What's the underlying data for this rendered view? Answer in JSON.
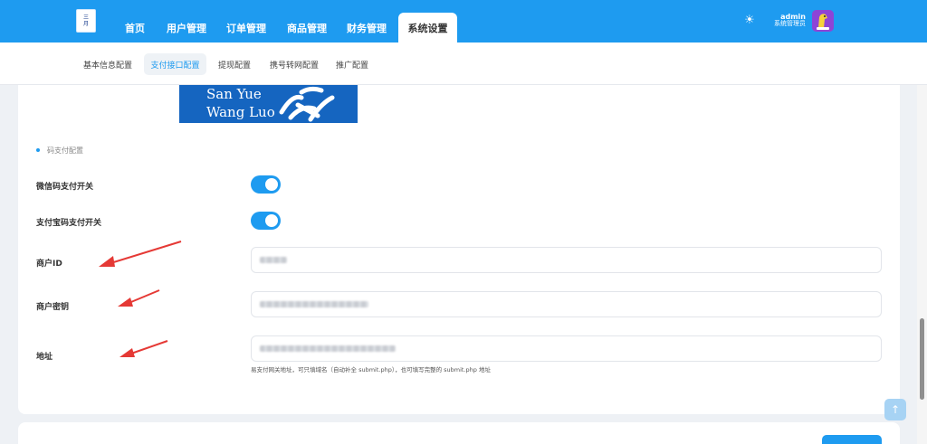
{
  "logo": {
    "chars": [
      "三",
      "月",
      "网",
      "络"
    ]
  },
  "nav": {
    "items": [
      {
        "label": "首页",
        "active": false
      },
      {
        "label": "用户管理",
        "active": false
      },
      {
        "label": "订单管理",
        "active": false
      },
      {
        "label": "商品管理",
        "active": false
      },
      {
        "label": "财务管理",
        "active": false
      },
      {
        "label": "系统设置",
        "active": true
      }
    ]
  },
  "header": {
    "theme_icon": "sun-icon",
    "user_name": "admin",
    "user_role": "系统管理员"
  },
  "subnav": {
    "items": [
      {
        "label": "基本信息配置",
        "active": false
      },
      {
        "label": "支付接口配置",
        "active": true
      },
      {
        "label": "提现配置",
        "active": false
      },
      {
        "label": "携号转网配置",
        "active": false
      },
      {
        "label": "推广配置",
        "active": false
      }
    ]
  },
  "banner": {
    "line1": "San Yue",
    "line2": "Wang Luo"
  },
  "section": {
    "title": "码支付配置"
  },
  "form": {
    "wechat_switch": {
      "label": "微信码支付开关",
      "on": true
    },
    "alipay_switch": {
      "label": "支付宝码支付开关",
      "on": true
    },
    "merchant_id": {
      "label": "商户ID"
    },
    "merchant_key": {
      "label": "商户密钥"
    },
    "address": {
      "label": "地址",
      "help": "易支付网关地址，可只填域名（自动补全 submit.php），也可填写完整的 submit.php 地址"
    }
  },
  "colors": {
    "primary": "#1e9bf0",
    "arrow": "#e53935",
    "background": "#eef1f5"
  },
  "icons": {
    "back_to_top": "arrow-up-icon",
    "theme": "sun-icon"
  }
}
